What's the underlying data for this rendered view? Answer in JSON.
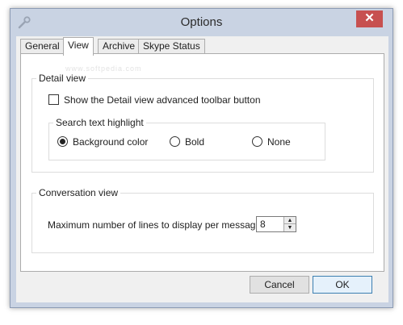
{
  "window": {
    "title": "Options",
    "close_glyph": "✕",
    "app_icon": "wrench-icon"
  },
  "tabs": [
    {
      "label": "General",
      "active": false
    },
    {
      "label": "View",
      "active": true
    },
    {
      "label": "Archive",
      "active": false
    },
    {
      "label": "Skype Status",
      "active": false
    }
  ],
  "watermark": "www.softpedia.com",
  "detail_view": {
    "legend": "Detail view",
    "show_toolbar_label": "Show the Detail view advanced toolbar button",
    "show_toolbar_checked": false,
    "search_highlight": {
      "legend": "Search text highlight",
      "options": [
        {
          "label": "Background color",
          "checked": true
        },
        {
          "label": "Bold",
          "checked": false
        },
        {
          "label": "None",
          "checked": false
        }
      ]
    }
  },
  "conversation_view": {
    "legend": "Conversation view",
    "max_lines_label": "Maximum number of lines to display per message row:",
    "max_lines_value": "8"
  },
  "footer": {
    "cancel_label": "Cancel",
    "ok_label": "OK"
  }
}
